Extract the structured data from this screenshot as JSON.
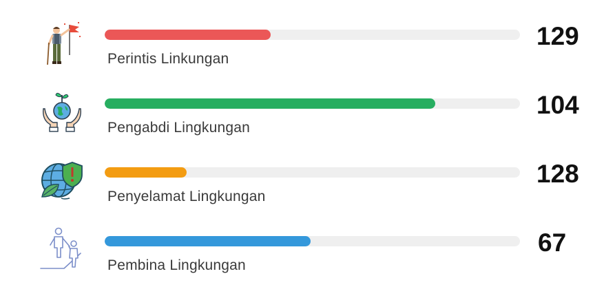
{
  "items": [
    {
      "label": "Perintis Linkungan",
      "count": "129",
      "color": "#eb5757",
      "fill_percent": 40,
      "icon": "pioneer-flag-icon"
    },
    {
      "label": "Pengabdi Lingkungan",
      "count": "104",
      "color": "#27ae60",
      "fill_percent": 79.6,
      "icon": "hands-globe-sprout-icon"
    },
    {
      "label": "Penyelamat Lingkungan",
      "count": "128",
      "color": "#f39c12",
      "fill_percent": 19.7,
      "icon": "globe-shield-leaf-icon"
    },
    {
      "label": "Pembina Lingkungan",
      "count": "67",
      "color": "#3498db",
      "fill_percent": 49.6,
      "icon": "helping-hand-climb-icon"
    }
  ]
}
